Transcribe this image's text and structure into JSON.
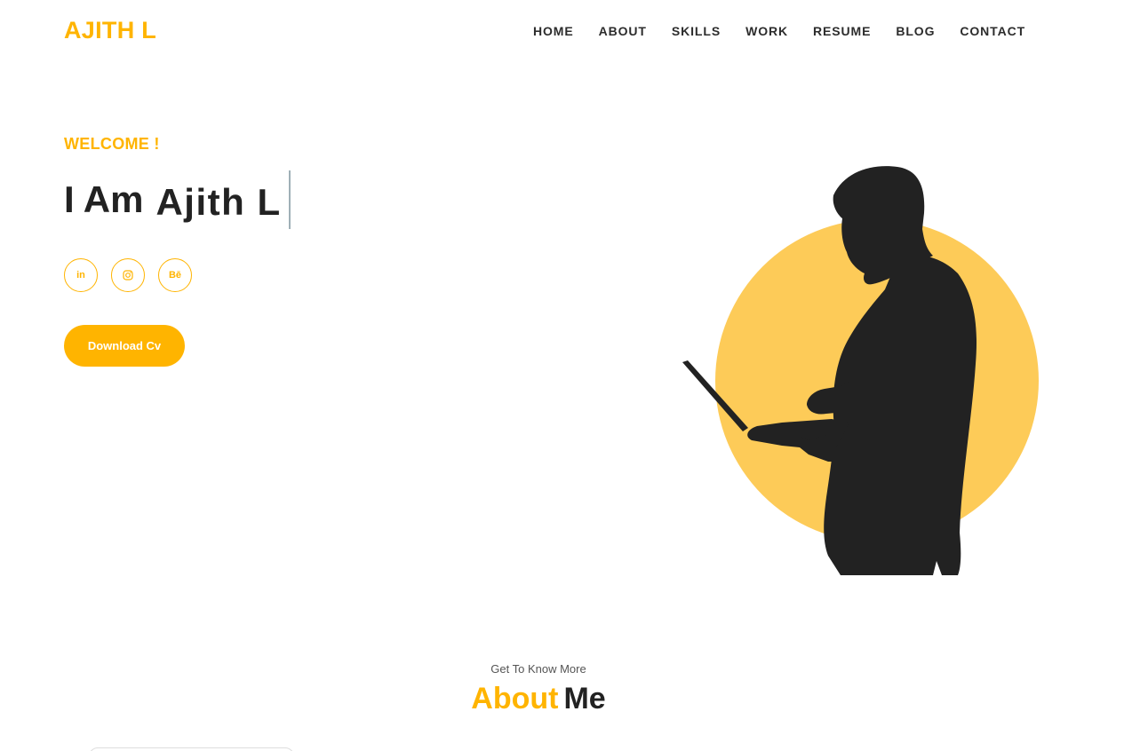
{
  "header": {
    "logo": "AJITH L",
    "nav": [
      {
        "label": "HOME"
      },
      {
        "label": "ABOUT"
      },
      {
        "label": "SKILLS"
      },
      {
        "label": "WORK"
      },
      {
        "label": "RESUME"
      },
      {
        "label": "BLOG"
      },
      {
        "label": "CONTACT"
      }
    ]
  },
  "hero": {
    "welcome": "WELCOME !",
    "headline_prefix": "I Am",
    "headline_name": "Ajith L",
    "socials": [
      {
        "icon": "linkedin-icon",
        "glyph": "in"
      },
      {
        "icon": "instagram-icon",
        "glyph": ""
      },
      {
        "icon": "behance-icon",
        "glyph": "Bē"
      }
    ],
    "cta_label": "Download Cv"
  },
  "about": {
    "kicker": "Get To Know More",
    "title_accent": "About",
    "title_rest": "Me"
  },
  "colors": {
    "accent": "#ffb400",
    "text": "#222222",
    "circle": "#fdcb58"
  }
}
